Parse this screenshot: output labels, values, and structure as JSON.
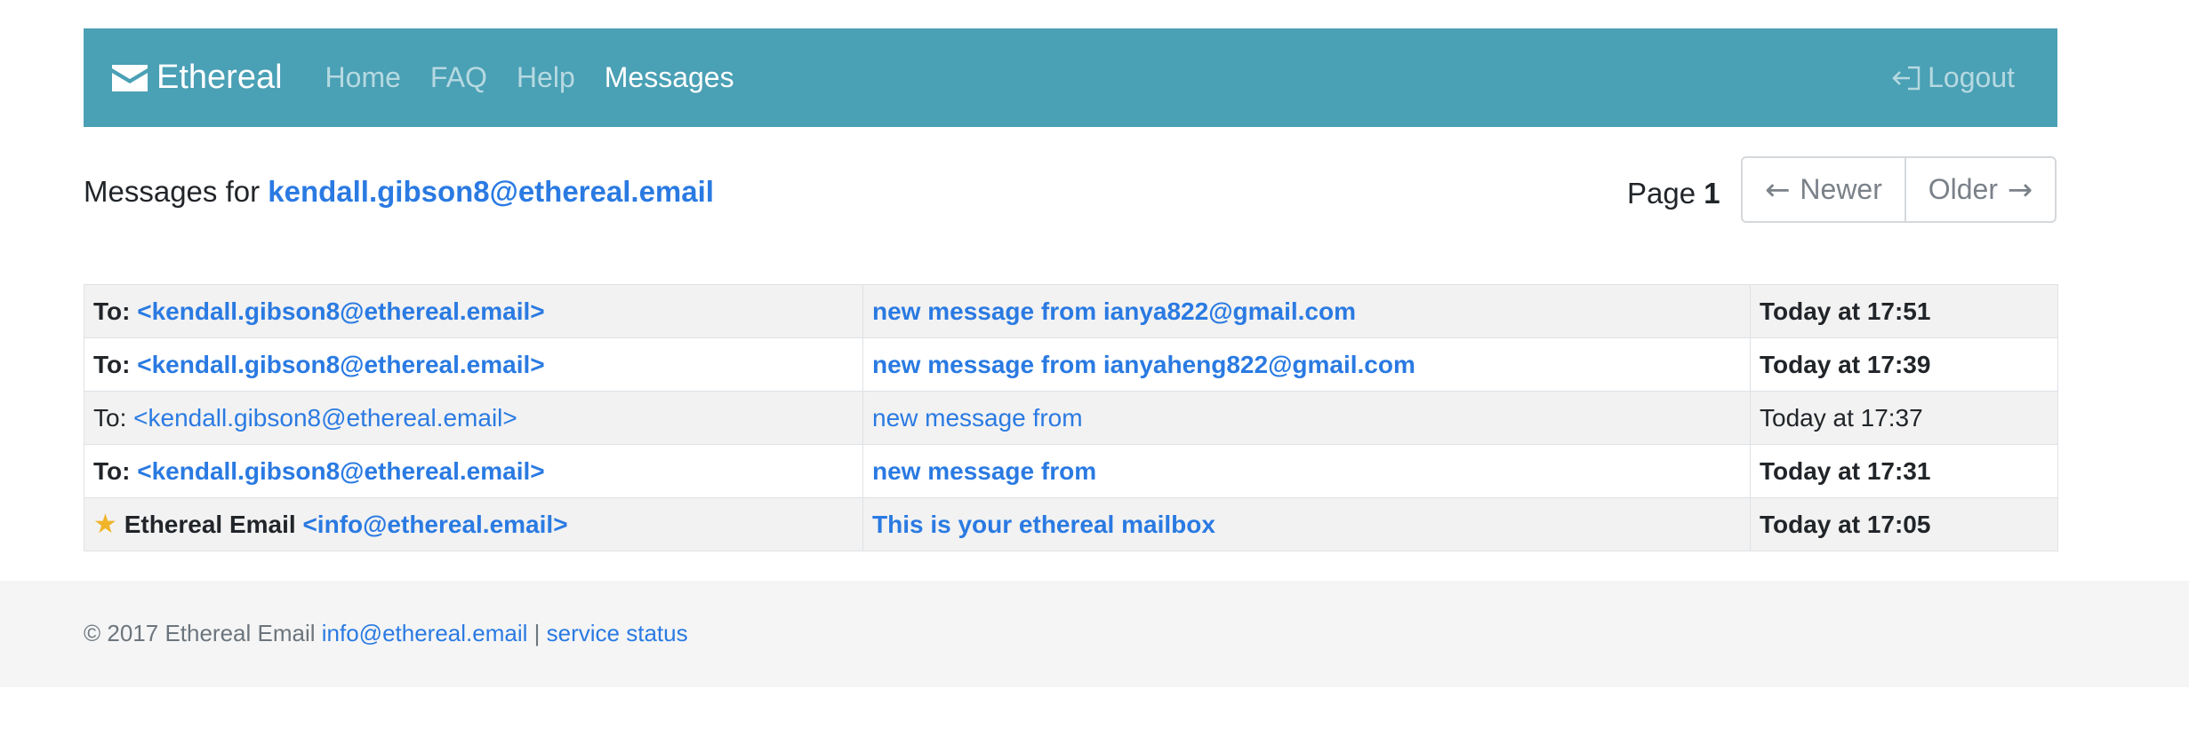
{
  "navbar": {
    "brand": "Ethereal",
    "links": [
      "Home",
      "FAQ",
      "Help",
      "Messages"
    ],
    "active_link": "Messages",
    "logout_label": "Logout"
  },
  "heading": {
    "prefix": "Messages for",
    "email": "kendall.gibson8@ethereal.email"
  },
  "pager": {
    "label": "Page",
    "page_number": "1",
    "newer_label": "Newer",
    "older_label": "Older"
  },
  "messages": [
    {
      "to_label": "To:",
      "recipient": "<kendall.gibson8@ethereal.email>",
      "subject": "new message from ianya822@gmail.com",
      "time": "Today at 17:51",
      "unread": true
    },
    {
      "to_label": "To:",
      "recipient": "<kendall.gibson8@ethereal.email>",
      "subject": "new message from ianyaheng822@gmail.com",
      "time": "Today at 17:39",
      "unread": true
    },
    {
      "to_label": "To:",
      "recipient": "<kendall.gibson8@ethereal.email>",
      "subject": "new message from",
      "time": "Today at 17:37",
      "unread": false
    },
    {
      "to_label": "To:",
      "recipient": "<kendall.gibson8@ethereal.email>",
      "subject": "new message from",
      "time": "Today at 17:31",
      "unread": true
    },
    {
      "sender": "Ethereal Email",
      "recipient": "<info@ethereal.email>",
      "subject": "This is your ethereal mailbox",
      "time": "Today at 17:05",
      "unread": true,
      "starred": true
    }
  ],
  "footer": {
    "copyright": "© 2017 Ethereal Email",
    "email_link": "info@ethereal.email",
    "separator": "|",
    "status_link": "service status"
  },
  "colors": {
    "navbar": "#4aa0b5",
    "link": "#2a7ae2",
    "star": "#f0b429"
  }
}
